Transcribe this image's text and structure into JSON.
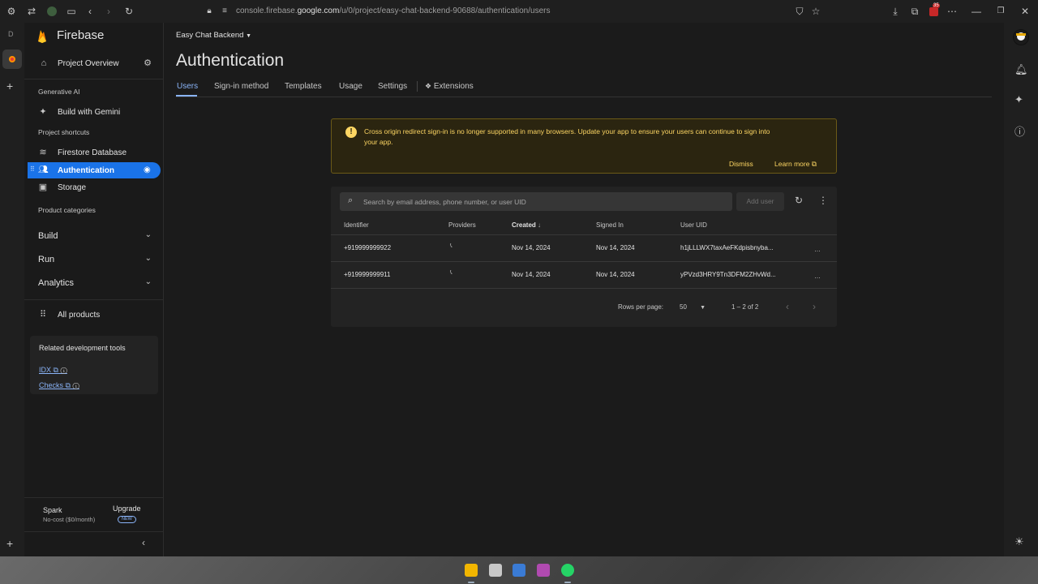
{
  "browser": {
    "url_prefix": "console.firebase.",
    "url_domain": "google.com",
    "url_path": "/u/0/project/easy-chat-backend-90688/authentication/users",
    "badge": "35"
  },
  "tab_strip": {
    "letter": "D"
  },
  "sidebar": {
    "brand": "Firebase",
    "project_overview": "Project Overview",
    "generative_ai": "Generative AI",
    "build_with_gemini": "Build with Gemini",
    "project_shortcuts": "Project shortcuts",
    "shortcuts": [
      "Firestore Database",
      "Authentication",
      "Storage"
    ],
    "product_categories": "Product categories",
    "categories": [
      "Build",
      "Run",
      "Analytics"
    ],
    "all_products": "All products",
    "related_tools_title": "Related development tools",
    "related_tools": [
      "IDX",
      "Checks"
    ],
    "plan_name": "Spark",
    "plan_desc": "No-cost ($0/month)",
    "upgrade": "Upgrade",
    "new_badge": "NEW"
  },
  "main": {
    "project_name": "Easy Chat Backend",
    "page_title": "Authentication",
    "tabs": [
      "Users",
      "Sign-in method",
      "Templates",
      "Usage",
      "Settings",
      "Extensions"
    ],
    "active_tab": "Users"
  },
  "banner": {
    "message_line1": "Cross origin redirect sign-in is no longer supported in many browsers. Update your app to ensure your users can continue to sign into",
    "message_line2": "your app.",
    "dismiss": "Dismiss",
    "learn_more": "Learn more"
  },
  "users_table": {
    "search_placeholder": "Search by email address, phone number, or user UID",
    "add_user": "Add user",
    "columns": [
      "Identifier",
      "Providers",
      "Created",
      "Signed In",
      "User UID"
    ],
    "rows": [
      {
        "identifier": "+919999999922",
        "created": "Nov 14, 2024",
        "signed_in": "Nov 14, 2024",
        "uid": "h1jLLLWX7taxAeFKdpisbnyba..."
      },
      {
        "identifier": "+919999999911",
        "created": "Nov 14, 2024",
        "signed_in": "Nov 14, 2024",
        "uid": "yPVzd3HRY9Tn3DFM2ZHvWd..."
      }
    ],
    "rows_per_page_label": "Rows per page:",
    "rows_per_page": "50",
    "range": "1 – 2 of 2"
  },
  "colors": {
    "accent": "#8ab4f8",
    "warning_bg": "#2d2710",
    "warning_text": "#fdd663",
    "active_nav": "#1a73e8"
  }
}
